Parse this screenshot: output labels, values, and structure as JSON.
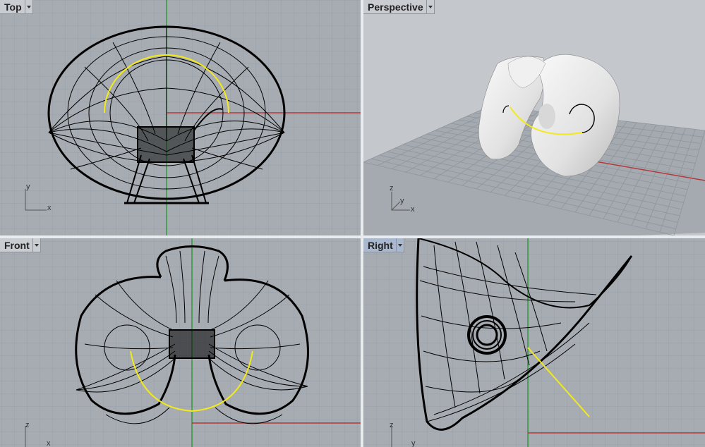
{
  "viewports": {
    "top": {
      "label": "Top",
      "axis_x": "x",
      "axis_y": "y"
    },
    "perspective": {
      "label": "Perspective",
      "axis_x": "x",
      "axis_y": "y",
      "axis_z": "z"
    },
    "front": {
      "label": "Front",
      "axis_x": "x",
      "axis_z": "z"
    },
    "right": {
      "label": "Right",
      "axis_y": "y",
      "axis_z": "z"
    }
  },
  "colors": {
    "viewport_bg": "#a7acb3",
    "perspective_bg": "#c4c8cd",
    "grid_line": "#9aa0a8",
    "x_axis": "#b23a3a",
    "y_axis": "#2e9a3c",
    "wire": "#000000",
    "selected_curve": "#f2ea1a",
    "active_tab": "#aab8cf"
  },
  "icons": {
    "tab_menu": "dropdown-arrow-icon"
  }
}
